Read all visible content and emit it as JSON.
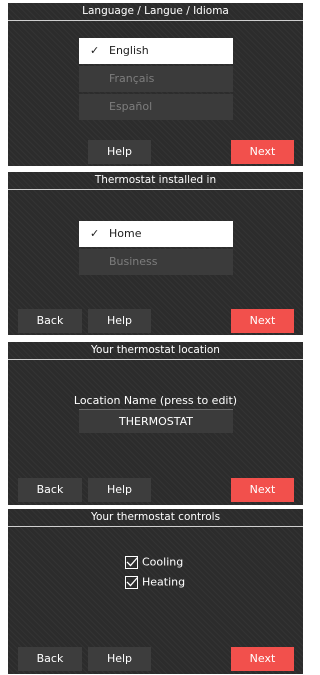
{
  "screens": {
    "language": {
      "title": "Language / Langue / Idioma",
      "options": [
        "English",
        "Français",
        "Español"
      ],
      "selected": "English",
      "help_label": "Help",
      "next_label": "Next"
    },
    "installed": {
      "title": "Thermostat installed in",
      "options": [
        "Home",
        "Business"
      ],
      "selected": "Home",
      "back_label": "Back",
      "help_label": "Help",
      "next_label": "Next"
    },
    "location": {
      "title": "Your thermostat location",
      "field_label": "Location Name (press to edit)",
      "field_value": "THERMOSTAT",
      "back_label": "Back",
      "help_label": "Help",
      "next_label": "Next"
    },
    "controls": {
      "title": "Your thermostat controls",
      "checkboxes": [
        {
          "label": "Cooling",
          "checked": true
        },
        {
          "label": "Heating",
          "checked": true
        }
      ],
      "back_label": "Back",
      "help_label": "Help",
      "next_label": "Next"
    }
  },
  "colors": {
    "next_button": "#f2504c",
    "panel_background": "#2c2c2c",
    "selected_option": "#ffffff"
  }
}
